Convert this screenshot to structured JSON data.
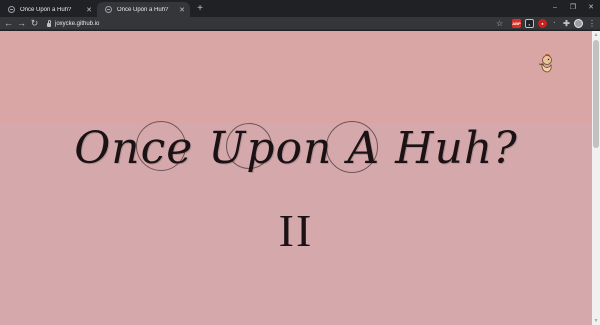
{
  "browser": {
    "tabs": [
      {
        "title": "Once Upon a Huh?",
        "active": false
      },
      {
        "title": "Once Upon a Huh?",
        "active": true
      }
    ],
    "new_tab_icon": "+",
    "window_controls": {
      "minimize": "–",
      "maximize": "❐",
      "close": "✕"
    },
    "close_glyph": "✕"
  },
  "toolbar": {
    "back": "←",
    "forward": "→",
    "reload": "↻",
    "url": "joxycke.github.io",
    "bookmark_glyph": "☆",
    "extensions": [
      "ABP",
      "◐",
      "●",
      "·",
      "✚"
    ],
    "menu_glyph": "⋮"
  },
  "page": {
    "title": "Once Upon A Huh?",
    "numeral": "II",
    "background_top": "#daa6a5",
    "background_bottom": "#d5a8ac",
    "text_color": "#1a1214"
  },
  "scrollbar": {
    "up": "▲",
    "down": "▼"
  }
}
